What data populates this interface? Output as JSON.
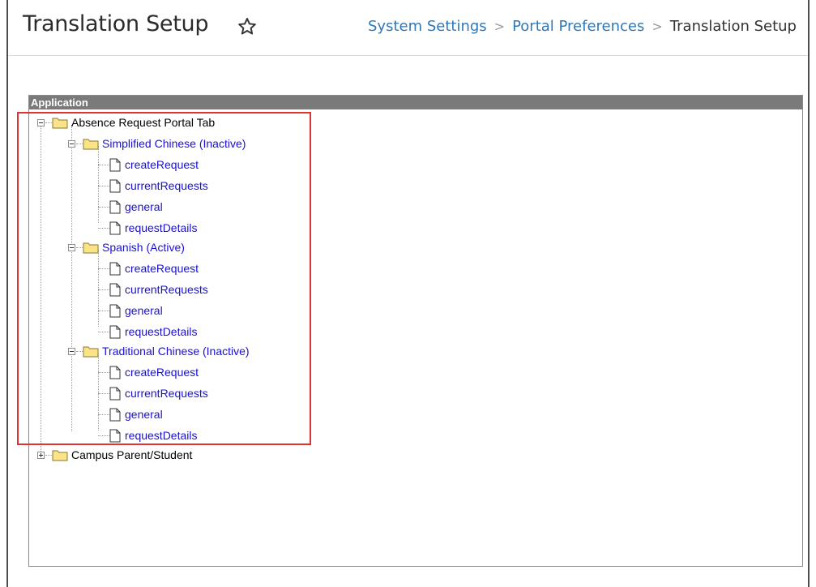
{
  "header": {
    "title": "Translation Setup",
    "breadcrumb": {
      "item1": "System Settings",
      "item2": "Portal Preferences",
      "current": "Translation Setup",
      "separator": ">"
    }
  },
  "panel": {
    "title": "Application",
    "tree": {
      "root1": {
        "label": "Absence Request Portal Tab",
        "languages": [
          {
            "label": "Simplified Chinese (Inactive)",
            "files": [
              "createRequest",
              "currentRequests",
              "general",
              "requestDetails"
            ]
          },
          {
            "label": "Spanish (Active)",
            "files": [
              "createRequest",
              "currentRequests",
              "general",
              "requestDetails"
            ]
          },
          {
            "label": "Traditional Chinese (Inactive)",
            "files": [
              "createRequest",
              "currentRequests",
              "general",
              "requestDetails"
            ]
          }
        ]
      },
      "root2": {
        "label": "Campus Parent/Student"
      }
    }
  },
  "colors": {
    "breadcrumb_link": "#2f78b7",
    "tree_link": "#1a0fd9",
    "panel_header_bg": "#7a7a7a",
    "highlight_border": "#e03434",
    "folder_fill": "#fbe38a"
  }
}
